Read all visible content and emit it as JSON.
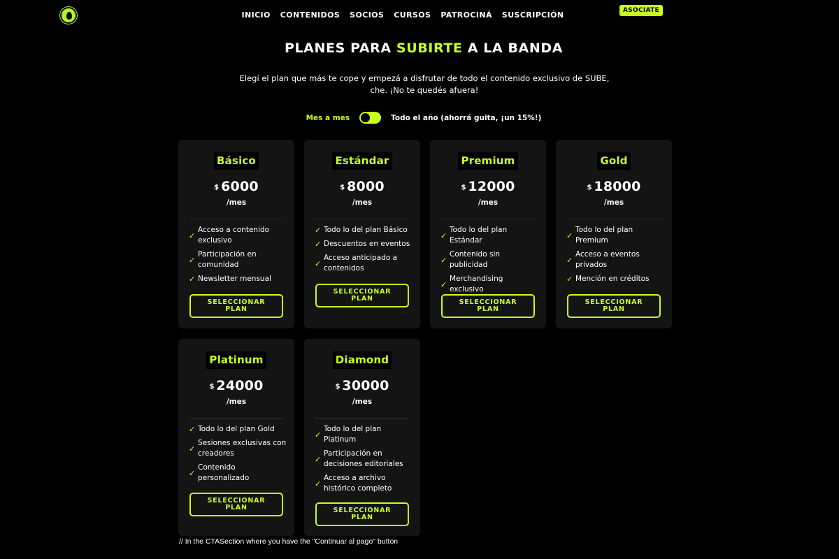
{
  "colors": {
    "accent": "#c8ff1e",
    "background": "#000000",
    "card": "#141414"
  },
  "header": {
    "logo_icon": "avocado-seed-icon",
    "nav": [
      "INICIO",
      "CONTENIDOS",
      "SOCIOS",
      "CURSOS",
      "PATROCINÁ",
      "SUSCRIPCIÓN"
    ],
    "cta_label": "ASOCIATE"
  },
  "hero": {
    "title_pre": "PLANES PARA ",
    "title_highlight": "SUBIRTE",
    "title_post": " A LA BANDA",
    "subtitle_line1": "Elegí el plan que más te cope y empezá a disfrutar de todo el contenido exclusivo de SUBE,",
    "subtitle_line2": "che. ¡No te quedés afuera!"
  },
  "billing_toggle": {
    "monthly_label": "Mes a mes",
    "yearly_label": "Todo el año (ahorrá guita, ¡un 15%!)",
    "selected": "monthly"
  },
  "plans": [
    {
      "name": "Básico",
      "currency": "$",
      "price": "6000",
      "period": "/mes",
      "features": [
        "Acceso a contenido exclusivo",
        "Participación en comunidad",
        "Newsletter mensual"
      ],
      "button": "SELECCIONAR PLAN"
    },
    {
      "name": "Estándar",
      "currency": "$",
      "price": "8000",
      "period": "/mes",
      "features": [
        "Todo lo del plan Básico",
        "Descuentos en eventos",
        "Acceso anticipado a contenidos"
      ],
      "button": "SELECCIONAR PLAN"
    },
    {
      "name": "Premium",
      "currency": "$",
      "price": "12000",
      "period": "/mes",
      "features": [
        "Todo lo del plan Estándar",
        "Contenido sin publicidad",
        "Merchandising exclusivo"
      ],
      "button": "SELECCIONAR PLAN"
    },
    {
      "name": "Gold",
      "currency": "$",
      "price": "18000",
      "period": "/mes",
      "features": [
        "Todo lo del plan Premium",
        "Acceso a eventos privados",
        "Mención en créditos"
      ],
      "button": "SELECCIONAR PLAN"
    },
    {
      "name": "Platinum",
      "currency": "$",
      "price": "24000",
      "period": "/mes",
      "features": [
        "Todo lo del plan Gold",
        "Sesiones exclusivas con creadores",
        "Contenido personalizado"
      ],
      "button": "SELECCIONAR PLAN"
    },
    {
      "name": "Diamond",
      "currency": "$",
      "price": "30000",
      "period": "/mes",
      "features": [
        "Todo lo del plan Platinum",
        "Participación en decisiones editoriales",
        "Acceso a archivo histórico completo"
      ],
      "button": "SELECCIONAR PLAN"
    }
  ],
  "footer_comment": "// In the CTASection where you have the \"Continuar al pago\" button"
}
